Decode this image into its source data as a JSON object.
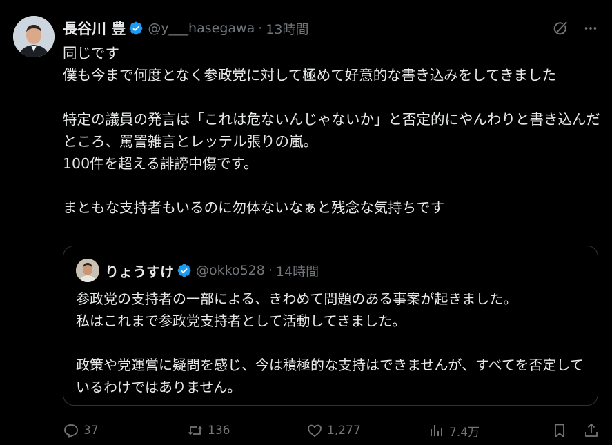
{
  "post": {
    "author_name": "長谷川 豊",
    "author_handle": "@y___hasegawa",
    "separator": "·",
    "time": "13時間",
    "text": "同じです\n僕も今まで何度となく参政党に対して極めて好意的な書き込みをしてきました\n\n特定の議員の発言は「これは危ないんじゃないか」と否定的にやんわりと書き込んだところ、罵詈雑言とレッテル張りの嵐。\n100件を超える誹謗中傷です。\n\nまともな支持者もいるのに勿体ないなぁと残念な気持ちです"
  },
  "quote": {
    "author_name": "りょうすけ",
    "author_handle": "@okko528",
    "separator": "·",
    "time": "14時間",
    "text": "参政党の支持者の一部による、きわめて問題のある事案が起きました。\n私はこれまで参政党支持者として活動してきました。\n\n政策や党運営に疑問を感じ、今は積極的な支持はできませんが、すべてを否定しているわけではありません。"
  },
  "actions": {
    "replies": "37",
    "reposts": "136",
    "likes": "1,277",
    "views": "7.4万"
  },
  "icons": {
    "verified": "verified-badge-icon",
    "grok": "grok-icon",
    "more": "more-icon",
    "reply": "reply-icon",
    "repost": "repost-icon",
    "like": "like-icon",
    "views": "views-icon",
    "bookmark": "bookmark-icon",
    "share": "share-icon"
  },
  "colors": {
    "background": "#000000",
    "text": "#e7e9ea",
    "secondary": "#71767b",
    "verified": "#1d9bf0",
    "border": "#2f3336"
  }
}
